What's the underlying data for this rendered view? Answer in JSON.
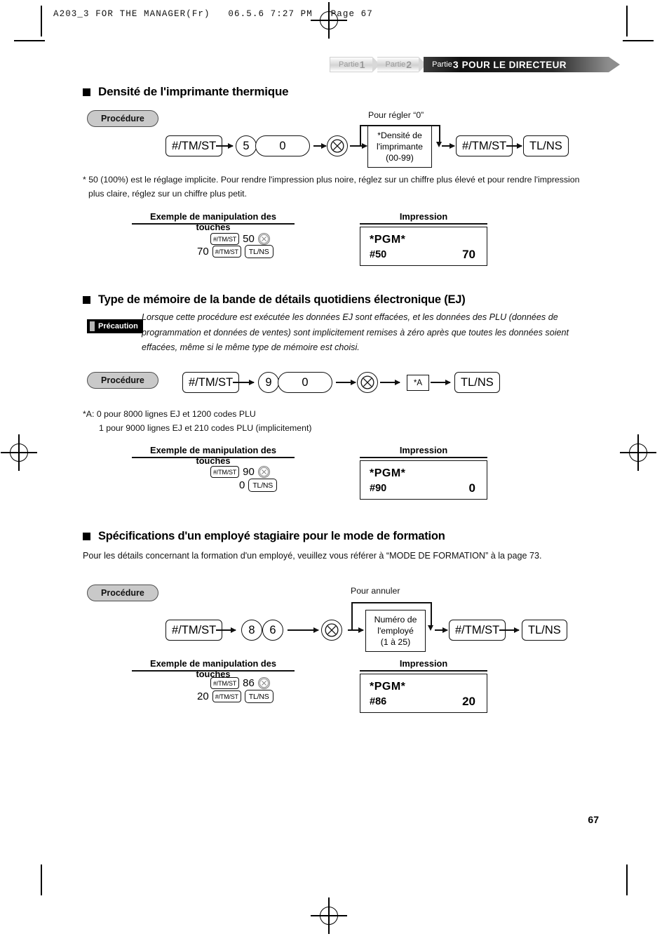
{
  "print_header": "A203_3 FOR THE MANAGER(Fr)   06.5.6 7:27 PM   Page 67",
  "tabs": {
    "part1_label": "Partie",
    "part1_num": "1",
    "part2_label": "Partie",
    "part2_num": "2",
    "part3_label": "Partie",
    "part3_num": "3",
    "part3_title": "POUR LE DIRECTEUR"
  },
  "procedure_label": "Procédure",
  "example_header": "Exemple de manipulation des touches",
  "impression_header": "Impression",
  "keys": {
    "tmst": "#/TM/ST",
    "tlns": "TL/NS",
    "multiply": "✕"
  },
  "sections": [
    {
      "title": "Densité de l'imprimante thermique",
      "bypass_label": "Pour régler “0”",
      "flow": {
        "key1": "#/TM/ST",
        "digit1": "5",
        "digit2": "0",
        "box_lines": [
          "*Densité de",
          "l'imprimante",
          "(00-99)"
        ],
        "key2": "#/TM/ST",
        "key3": "TL/NS"
      },
      "footnote": "* 50 (100%) est le réglage implicite. Pour rendre l'impression plus noire, réglez sur un chiffre plus élevé et pour rendre l'impression plus claire, réglez sur un chiffre plus petit.",
      "example": {
        "line1_key": "#/TM/ST",
        "line1_num": "50",
        "line1_x": "✕",
        "line2_pre": "70",
        "line2_key": "#/TM/ST",
        "line2_tl": "TL/NS"
      },
      "receipt": {
        "title": "*PGM*",
        "code": "#50",
        "value": "70"
      }
    },
    {
      "title": "Type de mémoire de la bande de détails quotidiens électronique (EJ)",
      "caution_label": "Précaution",
      "caution_text": "Lorsque cette procédure est exécutée les données EJ sont effacées, et les données des PLU (données de programmation et données de ventes) sont implicitement remises à zéro après que toutes les données soient effacées, même si le même type de mémoire est choisi.",
      "flow": {
        "key1": "#/TM/ST",
        "digit1": "9",
        "digit2": "0",
        "box_small": "*A",
        "key3": "TL/NS"
      },
      "footnote_line1": "*A: 0 pour 8000 lignes EJ et 1200 codes PLU",
      "footnote_line2": "1 pour 9000 lignes EJ et 210 codes PLU (implicitement)",
      "example": {
        "line1_key": "#/TM/ST",
        "line1_num": "90",
        "line1_x": "✕",
        "line2_pre": "0",
        "line2_tl": "TL/NS"
      },
      "receipt": {
        "title": "*PGM*",
        "code": "#90",
        "value": "0"
      }
    },
    {
      "title": "Spécifications d'un employé stagiaire pour le mode de formation",
      "body": "Pour les détails concernant la formation d'un employé, veuillez vous référer à “MODE DE FORMATION” à la page 73.",
      "bypass_label": "Pour annuler",
      "flow": {
        "key1": "#/TM/ST",
        "digit1": "8",
        "digit2": "6",
        "box_lines": [
          "Numéro de",
          "l'employé",
          "(1 à 25)"
        ],
        "key2": "#/TM/ST",
        "key3": "TL/NS"
      },
      "example": {
        "line1_key": "#/TM/ST",
        "line1_num": "86",
        "line1_x": "✕",
        "line2_pre": "20",
        "line2_key": "#/TM/ST",
        "line2_tl": "TL/NS"
      },
      "receipt": {
        "title": "*PGM*",
        "code": "#86",
        "value": "20"
      }
    }
  ],
  "page_number": "67"
}
